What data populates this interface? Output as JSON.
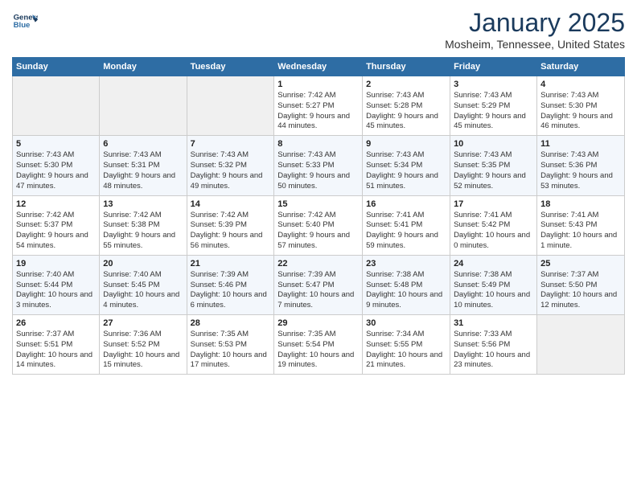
{
  "header": {
    "logo_line1": "General",
    "logo_line2": "Blue",
    "title": "January 2025",
    "subtitle": "Mosheim, Tennessee, United States"
  },
  "weekdays": [
    "Sunday",
    "Monday",
    "Tuesday",
    "Wednesday",
    "Thursday",
    "Friday",
    "Saturday"
  ],
  "weeks": [
    [
      {
        "day": "",
        "text": ""
      },
      {
        "day": "",
        "text": ""
      },
      {
        "day": "",
        "text": ""
      },
      {
        "day": "1",
        "text": "Sunrise: 7:42 AM\nSunset: 5:27 PM\nDaylight: 9 hours and 44 minutes."
      },
      {
        "day": "2",
        "text": "Sunrise: 7:43 AM\nSunset: 5:28 PM\nDaylight: 9 hours and 45 minutes."
      },
      {
        "day": "3",
        "text": "Sunrise: 7:43 AM\nSunset: 5:29 PM\nDaylight: 9 hours and 45 minutes."
      },
      {
        "day": "4",
        "text": "Sunrise: 7:43 AM\nSunset: 5:30 PM\nDaylight: 9 hours and 46 minutes."
      }
    ],
    [
      {
        "day": "5",
        "text": "Sunrise: 7:43 AM\nSunset: 5:30 PM\nDaylight: 9 hours and 47 minutes."
      },
      {
        "day": "6",
        "text": "Sunrise: 7:43 AM\nSunset: 5:31 PM\nDaylight: 9 hours and 48 minutes."
      },
      {
        "day": "7",
        "text": "Sunrise: 7:43 AM\nSunset: 5:32 PM\nDaylight: 9 hours and 49 minutes."
      },
      {
        "day": "8",
        "text": "Sunrise: 7:43 AM\nSunset: 5:33 PM\nDaylight: 9 hours and 50 minutes."
      },
      {
        "day": "9",
        "text": "Sunrise: 7:43 AM\nSunset: 5:34 PM\nDaylight: 9 hours and 51 minutes."
      },
      {
        "day": "10",
        "text": "Sunrise: 7:43 AM\nSunset: 5:35 PM\nDaylight: 9 hours and 52 minutes."
      },
      {
        "day": "11",
        "text": "Sunrise: 7:43 AM\nSunset: 5:36 PM\nDaylight: 9 hours and 53 minutes."
      }
    ],
    [
      {
        "day": "12",
        "text": "Sunrise: 7:42 AM\nSunset: 5:37 PM\nDaylight: 9 hours and 54 minutes."
      },
      {
        "day": "13",
        "text": "Sunrise: 7:42 AM\nSunset: 5:38 PM\nDaylight: 9 hours and 55 minutes."
      },
      {
        "day": "14",
        "text": "Sunrise: 7:42 AM\nSunset: 5:39 PM\nDaylight: 9 hours and 56 minutes."
      },
      {
        "day": "15",
        "text": "Sunrise: 7:42 AM\nSunset: 5:40 PM\nDaylight: 9 hours and 57 minutes."
      },
      {
        "day": "16",
        "text": "Sunrise: 7:41 AM\nSunset: 5:41 PM\nDaylight: 9 hours and 59 minutes."
      },
      {
        "day": "17",
        "text": "Sunrise: 7:41 AM\nSunset: 5:42 PM\nDaylight: 10 hours and 0 minutes."
      },
      {
        "day": "18",
        "text": "Sunrise: 7:41 AM\nSunset: 5:43 PM\nDaylight: 10 hours and 1 minute."
      }
    ],
    [
      {
        "day": "19",
        "text": "Sunrise: 7:40 AM\nSunset: 5:44 PM\nDaylight: 10 hours and 3 minutes."
      },
      {
        "day": "20",
        "text": "Sunrise: 7:40 AM\nSunset: 5:45 PM\nDaylight: 10 hours and 4 minutes."
      },
      {
        "day": "21",
        "text": "Sunrise: 7:39 AM\nSunset: 5:46 PM\nDaylight: 10 hours and 6 minutes."
      },
      {
        "day": "22",
        "text": "Sunrise: 7:39 AM\nSunset: 5:47 PM\nDaylight: 10 hours and 7 minutes."
      },
      {
        "day": "23",
        "text": "Sunrise: 7:38 AM\nSunset: 5:48 PM\nDaylight: 10 hours and 9 minutes."
      },
      {
        "day": "24",
        "text": "Sunrise: 7:38 AM\nSunset: 5:49 PM\nDaylight: 10 hours and 10 minutes."
      },
      {
        "day": "25",
        "text": "Sunrise: 7:37 AM\nSunset: 5:50 PM\nDaylight: 10 hours and 12 minutes."
      }
    ],
    [
      {
        "day": "26",
        "text": "Sunrise: 7:37 AM\nSunset: 5:51 PM\nDaylight: 10 hours and 14 minutes."
      },
      {
        "day": "27",
        "text": "Sunrise: 7:36 AM\nSunset: 5:52 PM\nDaylight: 10 hours and 15 minutes."
      },
      {
        "day": "28",
        "text": "Sunrise: 7:35 AM\nSunset: 5:53 PM\nDaylight: 10 hours and 17 minutes."
      },
      {
        "day": "29",
        "text": "Sunrise: 7:35 AM\nSunset: 5:54 PM\nDaylight: 10 hours and 19 minutes."
      },
      {
        "day": "30",
        "text": "Sunrise: 7:34 AM\nSunset: 5:55 PM\nDaylight: 10 hours and 21 minutes."
      },
      {
        "day": "31",
        "text": "Sunrise: 7:33 AM\nSunset: 5:56 PM\nDaylight: 10 hours and 23 minutes."
      },
      {
        "day": "",
        "text": ""
      }
    ]
  ]
}
